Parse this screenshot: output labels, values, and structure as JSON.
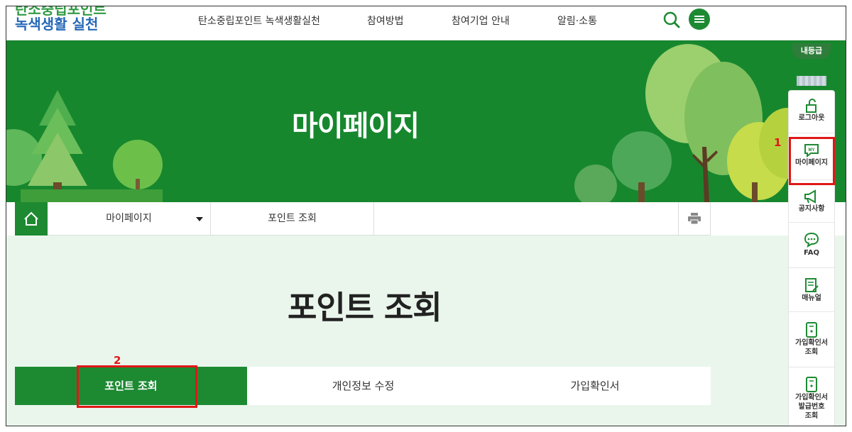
{
  "header": {
    "logo_line1": "탄소중립포인트",
    "logo_line2": "녹색생활 실천",
    "nav": [
      "탄소중립포인트 녹색생활실천",
      "참여방법",
      "참여기업 안내",
      "알림·소통"
    ]
  },
  "banner": {
    "title": "마이페이지"
  },
  "breadcrumb": {
    "level1": "마이페이지",
    "level2": "포인트 조회"
  },
  "content": {
    "title": "포인트 조회",
    "tabs": [
      "포인트 조회",
      "개인정보 수정",
      "가입확인서"
    ]
  },
  "quick_menu": {
    "rank": "내등급",
    "items": [
      "로그아웃",
      "마이페이지",
      "공지사항",
      "FAQ",
      "매뉴얼",
      "가입확인서 조회",
      "가입확인서 발급번호 조회"
    ],
    "items_lines": {
      "logout": [
        "로그아웃"
      ],
      "mypage": [
        "마이페이지"
      ],
      "notice": [
        "공지사항"
      ],
      "faq": [
        "FAQ"
      ],
      "manual": [
        "매뉴얼"
      ],
      "confirm": [
        "가입확인서",
        "조회"
      ],
      "issue": [
        "가입확인서",
        "발급번호",
        "조회"
      ]
    }
  },
  "annotations": {
    "step1": "1",
    "step2": "2"
  },
  "colors": {
    "primary": "#1d8a32",
    "highlight": "#e01717",
    "content_bg": "#eaf6ec"
  }
}
